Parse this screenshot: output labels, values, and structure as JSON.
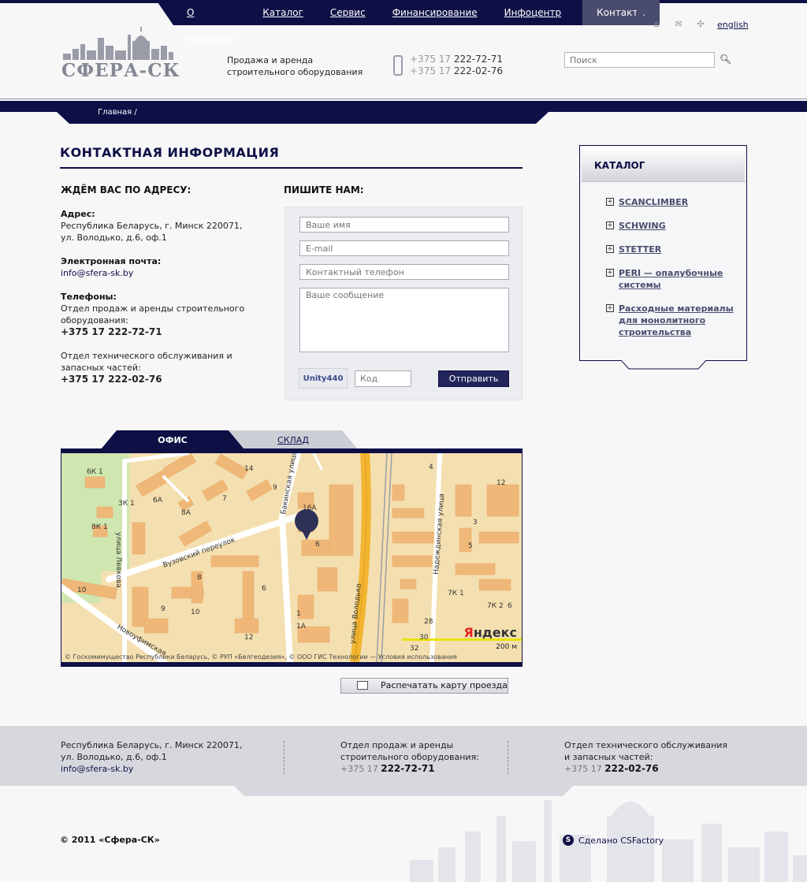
{
  "nav": {
    "items": [
      "О компании",
      "Каталог",
      "Сервис",
      "Финансирование",
      "Инфоцентр"
    ],
    "active": "Контакты"
  },
  "utils": {
    "home_icon": "home-icon",
    "mail_icon": "mail-icon",
    "sitemap_icon": "sitemap-icon",
    "lang": "english"
  },
  "header": {
    "logo_text": "СФЕРА-СК",
    "tagline": "Продажа и аренда строительного оборудования",
    "phone_code": "+375 17",
    "phone1": "222-72-71",
    "phone2": "222-02-76",
    "search_placeholder": "Поиск"
  },
  "breadcrumb": {
    "home": "Главная",
    "sep": "/"
  },
  "main": {
    "title": "КОНТАКТНАЯ ИНФОРМАЦИЯ",
    "address_head": "ЖДЁМ ВАС ПО АДРЕСУ:",
    "address_label": "Адрес:",
    "address_line1": "Республика Беларусь, г. Минск 220071,",
    "address_line2": "ул. Володько, д.6, оф.1",
    "email_label": "Электронная почта:",
    "email": "info@sfera-sk.by",
    "phones_label": "Телефоны:",
    "dept1_line1": "Отдел продаж и аренды строительного",
    "dept1_line2": "оборудования:",
    "dept1_phone": "+375 17 222-72-71",
    "dept2_line1": "Отдел технического обслуживания и",
    "dept2_line2": "запасных частей:",
    "dept2_phone": "+375 17 222-02-76"
  },
  "form": {
    "head": "ПИШИТЕ НАМ:",
    "name_placeholder": "Ваше имя",
    "email_placeholder": "E-mail",
    "phone_placeholder": "Контактный телефон",
    "message_placeholder": "Ваше сообщение",
    "captcha_text": "Unity440",
    "code_placeholder": "Код",
    "submit_label": "Отправить"
  },
  "catalog": {
    "title": "КАТАЛОГ",
    "items": [
      {
        "label": "SCANCLIMBER"
      },
      {
        "label": "SCHWING"
      },
      {
        "label": "STETTER"
      },
      {
        "label": "PERI — опалубочные системы"
      },
      {
        "label": "Расходные материалы для монолитного строительства"
      }
    ]
  },
  "map": {
    "tab_office": "ОФИС",
    "tab_warehouse": "СКЛАД",
    "streets": [
      "улица Левкова",
      "Вузовский переулок",
      "Бакинская улица",
      "улица Володько",
      "Надеждинская улица",
      "Новоуфимская"
    ],
    "house_numbers": [
      "6К 1",
      "14",
      "6А",
      "9",
      "3К 1",
      "7",
      "8А",
      "8К 1",
      "16А",
      "6",
      "8",
      "10",
      "9",
      "10",
      "6",
      "12",
      "1",
      "1А",
      "3",
      "5",
      "7К 1",
      "7К 2",
      "28",
      "30",
      "32",
      "4",
      "6",
      "12"
    ],
    "copyright": "© Госкомимущество Республики Беларусь, © РУП «Белгеодезия», © ООО ГИС Технологии — Условия использования",
    "logo_prefix": "Я",
    "logo_rest": "ндекс",
    "scale": "200 м"
  },
  "print_label": "Распечатать карту проезда",
  "footer": {
    "addr_line1": "Республика Беларусь, г. Минск 220071,",
    "addr_line2": "ул. Володько, д.6, оф.1",
    "email": "info@sfera-sk.by",
    "sales_line1": "Отдел продаж и аренды",
    "sales_line2": "строительного оборудования:",
    "sales_code": "+375 17",
    "sales_phone": "222-72-71",
    "service_line1": "Отдел технического обслуживания",
    "service_line2": "и запасных частей:",
    "service_code": "+375 17",
    "service_phone": "222-02-76",
    "copyright": "© 2011 «Сфера-СК»",
    "maker": "Сделано CSFactory"
  }
}
